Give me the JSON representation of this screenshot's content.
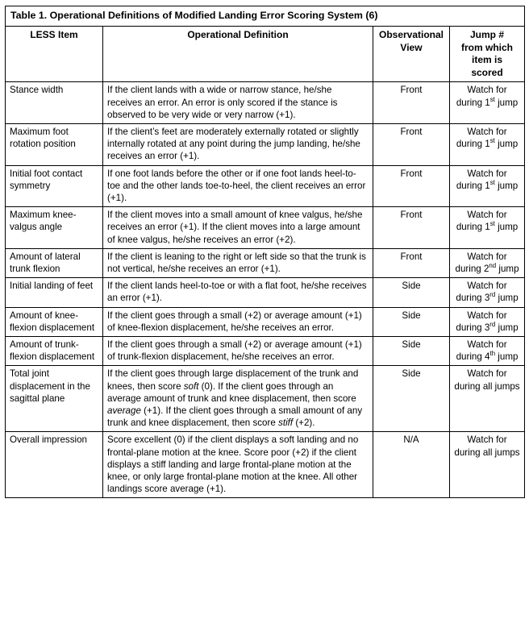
{
  "table": {
    "title": "Table 1. Operational Definitions of Modified Landing Error Scoring System (6)",
    "headers": {
      "item": "LESS Item",
      "definition": "Operational Definition",
      "view": "Observational View",
      "jump": "Jump # from which item is scored"
    },
    "header_lines": {
      "view_line1": "Observational",
      "view_line2": "View",
      "jump_line1": "Jump #",
      "jump_line2": "from which",
      "jump_line3": "item is",
      "jump_line4": "scored"
    },
    "rows": [
      {
        "item": "Stance width",
        "definition": "If the client lands with a wide or narrow stance, he/she receives an error. An error is only scored if the stance is observed to be very wide or very narrow (+1).",
        "view": "Front",
        "jump_pre": "Watch for during 1",
        "jump_ord": "st",
        "jump_post": " jump"
      },
      {
        "item": "Maximum foot rotation position",
        "definition": "If the client’s feet are moderately externally rotated or slightly internally rotated at any point during the jump landing, he/she receives an error (+1).",
        "view": "Front",
        "jump_pre": "Watch for during 1",
        "jump_ord": "st",
        "jump_post": " jump"
      },
      {
        "item": "Initial foot contact symmetry",
        "definition": "If one foot lands before the other or if one foot lands heel-to-toe and the other lands toe-to-heel, the client receives an error (+1).",
        "view": "Front",
        "jump_pre": "Watch for during 1",
        "jump_ord": "st",
        "jump_post": " jump"
      },
      {
        "item": "Maximum knee-valgus angle",
        "definition": "If the client moves into a small amount of knee valgus, he/she receives an error (+1). If the client moves into a large amount of knee valgus, he/she receives an error (+2).",
        "view": "Front",
        "jump_pre": "Watch for during 1",
        "jump_ord": "st",
        "jump_post": " jump"
      },
      {
        "item": "Amount of lateral trunk flexion",
        "definition": "If the client is leaning to the right or left side so that the trunk is not vertical, he/she receives an error (+1).",
        "view": "Front",
        "jump_pre": "Watch for during 2",
        "jump_ord": "nd",
        "jump_post": " jump"
      },
      {
        "item": "Initial landing of feet",
        "definition": "If the client lands heel-to-toe or with a flat foot, he/she receives an error (+1).",
        "view": "Side",
        "jump_pre": "Watch for during 3",
        "jump_ord": "rd",
        "jump_post": " jump"
      },
      {
        "item": "Amount of knee-flexion displacement",
        "definition": "If the client goes through a small (+2) or average amount (+1) of knee-flexion displacement, he/she receives an error.",
        "view": "Side",
        "jump_pre": "Watch for during 3",
        "jump_ord": "rd",
        "jump_post": " jump"
      },
      {
        "item": "Amount of trunk-flexion displacement",
        "definition": "If the client goes through a small (+2) or average amount (+1) of trunk-flexion displacement, he/she receives an error.",
        "view": "Side",
        "jump_pre": "Watch for during 4",
        "jump_ord": "th",
        "jump_post": " jump"
      },
      {
        "item": "Total joint displacement in the sagittal plane",
        "definition": "If the client goes through large displacement of the trunk and knees, then score soft (0). If the client goes through an average amount of trunk and knee displacement, then score average (+1). If the client goes through a small amount of any trunk and knee displacement, then score stiff (+2).",
        "definition_parts": [
          {
            "text": "If the client goes through large displacement of the trunk and knees, then score ",
            "italic": false
          },
          {
            "text": "soft",
            "italic": true
          },
          {
            "text": " (0). If the client goes through an average amount of trunk and knee displacement, then score ",
            "italic": false
          },
          {
            "text": "average",
            "italic": true
          },
          {
            "text": " (+1). If the client goes through a small amount of any trunk and knee displacement, then score ",
            "italic": false
          },
          {
            "text": "stiff",
            "italic": true
          },
          {
            "text": " (+2).",
            "italic": false
          }
        ],
        "view": "Side",
        "jump_pre": "Watch for during all jumps",
        "jump_ord": "",
        "jump_post": ""
      },
      {
        "item": "Overall impression",
        "definition": "Score excellent (0) if the client displays a soft landing and no frontal-plane motion at the knee. Score poor (+2) if the client displays a stiff landing and large frontal-plane motion at the knee, or only large frontal-plane motion at the knee. All other landings score average (+1).",
        "view": "N/A",
        "jump_pre": "Watch for during all jumps",
        "jump_ord": "",
        "jump_post": ""
      }
    ]
  }
}
